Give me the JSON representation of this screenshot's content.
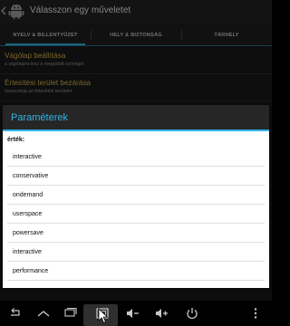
{
  "app": {
    "title": "Válasszon egy műveletet",
    "icon": "android-robot-icon"
  },
  "tabs": [
    {
      "label": "NYELV & BILLENTYŰZET",
      "selected": true
    },
    {
      "label": "HELY & BIZTONSÁG",
      "selected": false
    },
    {
      "label": "TÁRHELY",
      "selected": false
    }
  ],
  "preferences": [
    {
      "title": "Vágólap beállítása",
      "summary": "a vágólapra tesz a megadott szöveget"
    },
    {
      "title": "Értesítési terület bezárása",
      "summary": "összezárja az értesítési területet"
    }
  ],
  "dialog": {
    "title": "Paraméterek",
    "value_label": "érték:",
    "options": [
      "interactive",
      "conservative",
      "ondemand",
      "userspace",
      "powersave",
      "interactive",
      "performance"
    ]
  },
  "colors": {
    "accent": "#33b5e5",
    "pref_title": "#dcb84d",
    "background": "#1b1b1b"
  },
  "navbar": {
    "buttons": [
      "back-icon",
      "home-icon",
      "recent-apps-icon",
      "screenshot-icon",
      "volume-down-icon",
      "volume-up-icon",
      "power-icon"
    ]
  }
}
